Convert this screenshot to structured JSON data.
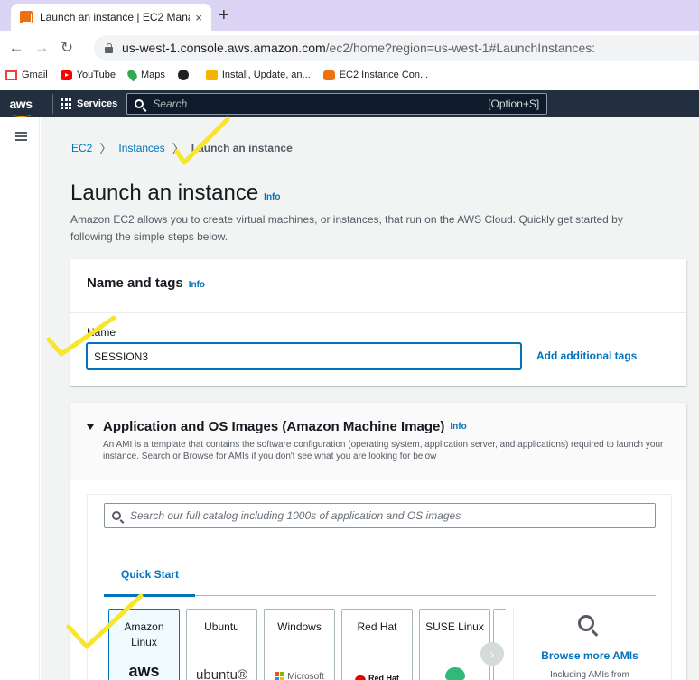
{
  "browser": {
    "tab_title": "Launch an instance | EC2 Mana",
    "tab_close": "×",
    "new_tab": "+",
    "url_host": "us-west-1.console.aws.amazon.com",
    "url_rest": "/ec2/home?region=us-west-1#LaunchInstances:",
    "bookmarks": [
      {
        "label": "Gmail",
        "icon": "gmail-icon"
      },
      {
        "label": "YouTube",
        "icon": "youtube-icon"
      },
      {
        "label": "Maps",
        "icon": "maps-icon"
      },
      {
        "label": "",
        "icon": "globe-icon"
      },
      {
        "label": "Install, Update, an...",
        "icon": "package-icon"
      },
      {
        "label": "EC2 Instance Con...",
        "icon": "cube-icon"
      }
    ]
  },
  "aws_nav": {
    "logo": "aws",
    "services": "Services",
    "search_placeholder": "Search",
    "shortcut": "[Option+S]"
  },
  "breadcrumb": {
    "items": [
      "EC2",
      "Instances"
    ],
    "current": "Launch an instance"
  },
  "page": {
    "title": "Launch an instance",
    "info": "Info",
    "description": "Amazon EC2 allows you to create virtual machines, or instances, that run on the AWS Cloud. Quickly get started by following the simple steps below."
  },
  "name_tags": {
    "heading": "Name and tags",
    "info": "Info",
    "label": "Name",
    "value": "SESSION3",
    "add_tags": "Add additional tags"
  },
  "ami": {
    "heading": "Application and OS Images (Amazon Machine Image)",
    "info": "Info",
    "description": "An AMI is a template that contains the software configuration (operating system, application server, and applications) required to launch your instance. Search or Browse for AMIs if you don't see what you are looking for below",
    "search_placeholder": "Search our full catalog including 1000s of application and OS images",
    "tab": "Quick Start",
    "os_options": [
      {
        "line1": "Amazon",
        "line2": "Linux",
        "logo": "aws"
      },
      {
        "line1": "Ubuntu",
        "line2": "",
        "logo": "ubuntu®"
      },
      {
        "line1": "Windows",
        "line2": "",
        "logo": "Microsoft"
      },
      {
        "line1": "Red Hat",
        "line2": "",
        "logo": "Red Hat"
      },
      {
        "line1": "SUSE Linux",
        "line2": "",
        "logo": ""
      }
    ],
    "next": "›",
    "browse_more": "Browse more AMIs",
    "browse_sub": "Including AMIs from"
  },
  "colors": {
    "aws_nav_bg": "#232f3e",
    "link_blue": "#0073bb",
    "annotation_yellow": "#f7e62a"
  }
}
